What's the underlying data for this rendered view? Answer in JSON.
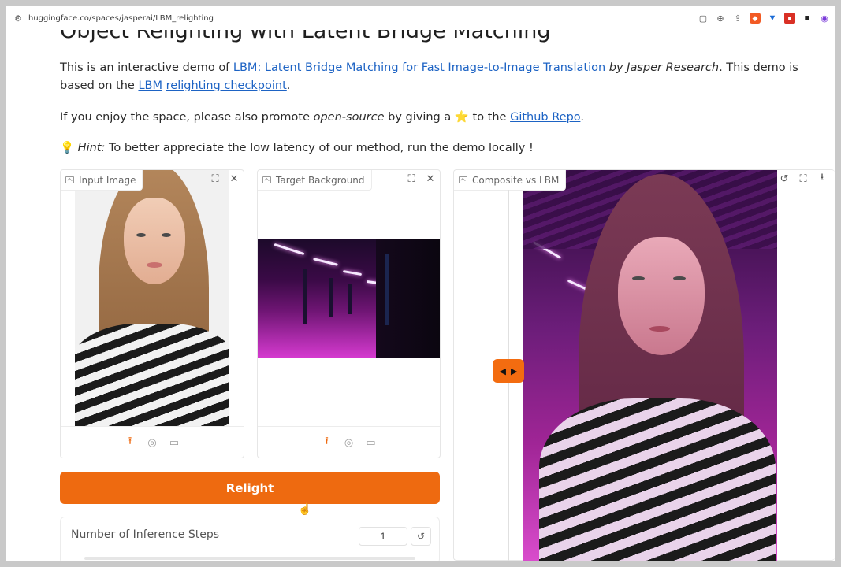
{
  "browser": {
    "url": "huggingface.co/spaces/jasperai/LBM_relighting"
  },
  "page": {
    "title": "Object Relighting with Latent Bridge Matching",
    "intro": {
      "text1": "This is an interactive demo of ",
      "link1": "LBM: Latent Bridge Matching for Fast Image-to-Image Translation",
      "text2": " by Jasper Research",
      "text3": ". This demo is based on the ",
      "link2a": "LBM",
      "link2b": "relighting checkpoint",
      "text4": "."
    },
    "promote": {
      "text1": "If you enjoy the space, please also promote ",
      "emph": "open-source",
      "text2": " by giving a ",
      "star": "⭐",
      "text3": " to the ",
      "link": "Github Repo",
      "text4": "."
    },
    "hint": {
      "bulb": "💡",
      "label": "Hint:",
      "text": " To better appreciate the low latency of our method, run the demo locally !"
    }
  },
  "panels": {
    "input_label": "Input Image",
    "target_label": "Target Background",
    "composite_label": "Composite vs LBM"
  },
  "relight_button": "Relight",
  "steps": {
    "label": "Number of Inference Steps",
    "value": "1",
    "reset": "↺"
  },
  "colors": {
    "accent": "#ee6a10",
    "link": "#1d63c4"
  }
}
